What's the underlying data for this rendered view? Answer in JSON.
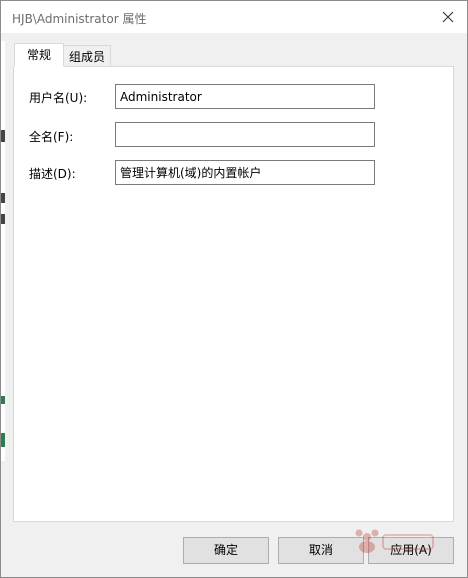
{
  "window": {
    "title": "HJB\\Administrator 属性"
  },
  "tabs": [
    {
      "label": "常规",
      "active": true
    },
    {
      "label": "组成员",
      "active": false
    }
  ],
  "form": {
    "username": {
      "label": "用户名(U):",
      "value": "Administrator"
    },
    "fullname": {
      "label": "全名(F):",
      "value": ""
    },
    "description": {
      "label": "描述(D):",
      "value": "管理计算机(域)的内置帐户"
    }
  },
  "buttons": {
    "ok": "确定",
    "cancel": "取消",
    "apply": "应用(A)"
  },
  "icons": {
    "close": "close-icon"
  },
  "colors": {
    "window_bg": "#f0f0f0",
    "panel_bg": "#ffffff",
    "title_text": "#6d6d6d",
    "border": "#d9d9d9"
  }
}
